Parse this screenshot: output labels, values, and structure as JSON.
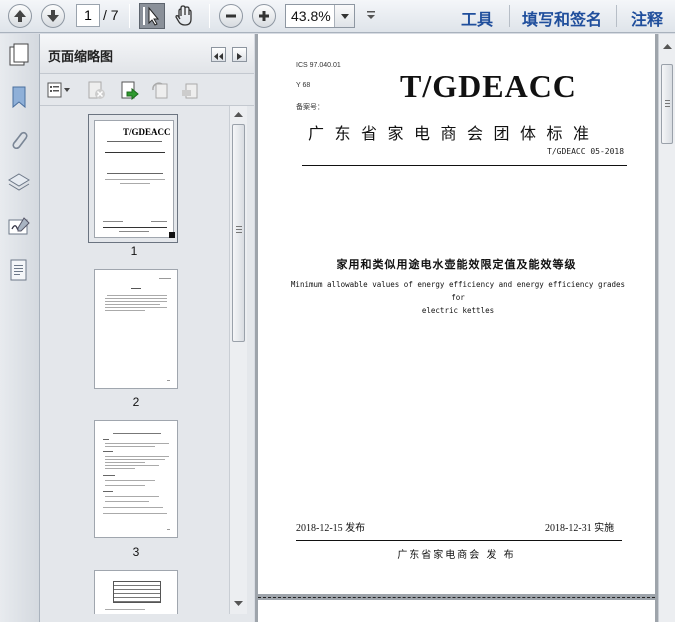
{
  "toolbar": {
    "current_page": "1",
    "total_pages": "/ 7",
    "zoom": "43.8%",
    "menu_tools": "工具",
    "menu_sign": "填写和签名",
    "menu_comment": "注释"
  },
  "panel": {
    "title": "页面缩略图",
    "thumbnails": [
      {
        "label": "1"
      },
      {
        "label": "2"
      },
      {
        "label": "3"
      }
    ]
  },
  "document": {
    "ics": "ICS 97.040.01",
    "y": "Y 68",
    "record_no": "备案号：",
    "logo": "T/GDEACC",
    "organization": "广东省家电商会团体标准",
    "code": "T/GDEACC 05-2018",
    "title_cn": "家用和类似用途电水壶能效限定值及能效等级",
    "title_en_line1": "Minimum allowable values of energy efficiency and energy efficiency grades for",
    "title_en_line2": "electric kettles",
    "issue_date": "2018-12-15 发布",
    "impl_date": "2018-12-31 实施",
    "publisher": "广东省家电商会   发 布",
    "thumb_logo": "T/GDEACC"
  }
}
